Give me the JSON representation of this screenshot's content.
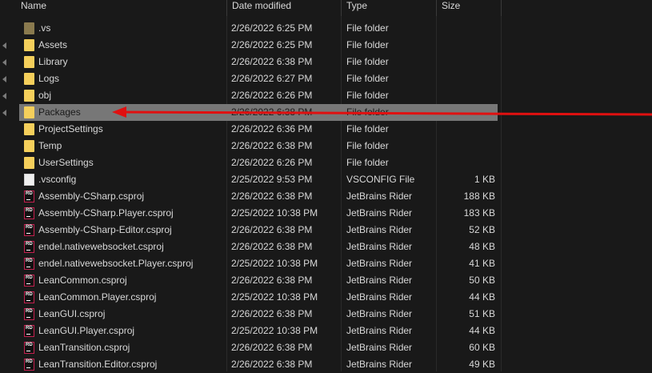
{
  "columns": {
    "name": "Name",
    "date": "Date modified",
    "type": "Type",
    "size": "Size"
  },
  "rows": [
    {
      "icon": "folder-dark-icon",
      "name": ".vs",
      "date": "2/26/2022 6:25 PM",
      "type": "File folder",
      "size": ""
    },
    {
      "icon": "folder-icon",
      "name": "Assets",
      "date": "2/26/2022 6:25 PM",
      "type": "File folder",
      "size": ""
    },
    {
      "icon": "folder-icon",
      "name": "Library",
      "date": "2/26/2022 6:38 PM",
      "type": "File folder",
      "size": ""
    },
    {
      "icon": "folder-icon",
      "name": "Logs",
      "date": "2/26/2022 6:27 PM",
      "type": "File folder",
      "size": ""
    },
    {
      "icon": "folder-icon",
      "name": "obj",
      "date": "2/26/2022 6:26 PM",
      "type": "File folder",
      "size": ""
    },
    {
      "icon": "folder-icon",
      "name": "Packages",
      "date": "2/26/2022 6:38 PM",
      "type": "File folder",
      "size": "",
      "selected": true
    },
    {
      "icon": "folder-icon",
      "name": "ProjectSettings",
      "date": "2/26/2022 6:36 PM",
      "type": "File folder",
      "size": ""
    },
    {
      "icon": "folder-icon",
      "name": "Temp",
      "date": "2/26/2022 6:38 PM",
      "type": "File folder",
      "size": ""
    },
    {
      "icon": "folder-icon",
      "name": "UserSettings",
      "date": "2/26/2022 6:26 PM",
      "type": "File folder",
      "size": ""
    },
    {
      "icon": "file-icon",
      "name": ".vsconfig",
      "date": "2/25/2022 9:53 PM",
      "type": "VSCONFIG File",
      "size": "1 KB"
    },
    {
      "icon": "rider-icon",
      "name": "Assembly-CSharp.csproj",
      "date": "2/26/2022 6:38 PM",
      "type": "JetBrains Rider",
      "size": "188 KB"
    },
    {
      "icon": "rider-icon",
      "name": "Assembly-CSharp.Player.csproj",
      "date": "2/25/2022 10:38 PM",
      "type": "JetBrains Rider",
      "size": "183 KB"
    },
    {
      "icon": "rider-icon",
      "name": "Assembly-CSharp-Editor.csproj",
      "date": "2/26/2022 6:38 PM",
      "type": "JetBrains Rider",
      "size": "52 KB"
    },
    {
      "icon": "rider-icon",
      "name": "endel.nativewebsocket.csproj",
      "date": "2/26/2022 6:38 PM",
      "type": "JetBrains Rider",
      "size": "48 KB"
    },
    {
      "icon": "rider-icon",
      "name": "endel.nativewebsocket.Player.csproj",
      "date": "2/25/2022 10:38 PM",
      "type": "JetBrains Rider",
      "size": "41 KB"
    },
    {
      "icon": "rider-icon",
      "name": "LeanCommon.csproj",
      "date": "2/26/2022 6:38 PM",
      "type": "JetBrains Rider",
      "size": "50 KB"
    },
    {
      "icon": "rider-icon",
      "name": "LeanCommon.Player.csproj",
      "date": "2/25/2022 10:38 PM",
      "type": "JetBrains Rider",
      "size": "44 KB"
    },
    {
      "icon": "rider-icon",
      "name": "LeanGUI.csproj",
      "date": "2/26/2022 6:38 PM",
      "type": "JetBrains Rider",
      "size": "51 KB"
    },
    {
      "icon": "rider-icon",
      "name": "LeanGUI.Player.csproj",
      "date": "2/25/2022 10:38 PM",
      "type": "JetBrains Rider",
      "size": "44 KB"
    },
    {
      "icon": "rider-icon",
      "name": "LeanTransition.csproj",
      "date": "2/26/2022 6:38 PM",
      "type": "JetBrains Rider",
      "size": "60 KB"
    },
    {
      "icon": "rider-icon",
      "name": "LeanTransition.Editor.csproj",
      "date": "2/26/2022 6:38 PM",
      "type": "JetBrains Rider",
      "size": "49 KB"
    }
  ],
  "rider_icon_text": "RD",
  "colors": {
    "background": "#191919",
    "text": "#d8d8d8",
    "selected_row": "#777777",
    "arrow": "#e01010",
    "folder": "#f5cf5b",
    "rider_border": "#c4204f"
  }
}
